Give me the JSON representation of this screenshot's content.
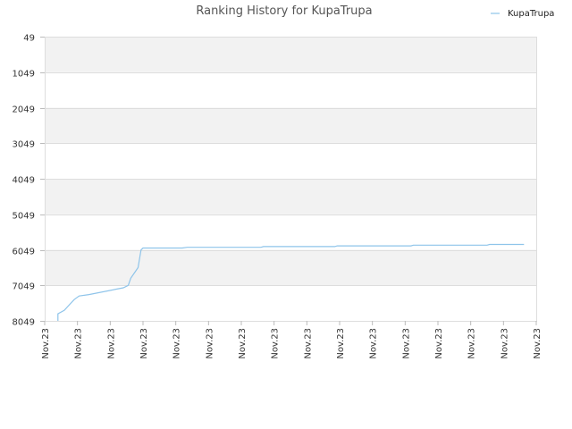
{
  "chart_data": {
    "type": "line",
    "title": "Ranking History for KupaTrupa",
    "xlabel": "",
    "ylabel": "",
    "y_inverted": true,
    "ylim": [
      49,
      8049
    ],
    "y_ticks": [
      "49",
      "1049",
      "2049",
      "3049",
      "4049",
      "5049",
      "6049",
      "7049",
      "8049"
    ],
    "x_ticks": [
      "Nov.23",
      "Nov.23",
      "Nov.23",
      "Nov.23",
      "Nov.23",
      "Nov.23",
      "Nov.23",
      "Nov.23",
      "Nov.23",
      "Nov.23",
      "Nov.23",
      "Nov.23",
      "Nov.23",
      "Nov.23",
      "Nov.23",
      "Nov.23"
    ],
    "grid": true,
    "alternating_bands": true,
    "legend_position": "top-right",
    "colors": {
      "series": "#8ec4ea",
      "band": "#f2f2f2",
      "grid": "#dddddd"
    },
    "series": [
      {
        "name": "KupaTrupa",
        "x_fraction_of_axis": [
          0.027,
          0.027,
          0.045,
          0.055,
          0.063,
          0.068,
          0.075,
          0.082,
          0.09,
          0.1,
          0.13,
          0.16,
          0.185,
          0.205,
          0.211,
          0.22,
          0.22,
          0.227,
          0.245,
          0.255,
          0.262,
          0.267,
          0.2,
          0.2
        ],
        "values": [
          8049,
          7849,
          7549,
          7449,
          7349,
          7329,
          7299,
          7279,
          7259,
          7229,
          7149,
          7069,
          6999,
          6999,
          6699,
          6599,
          6599,
          6549,
          6349,
          6099,
          5999,
          5999,
          5999,
          5999
        ]
      }
    ]
  }
}
